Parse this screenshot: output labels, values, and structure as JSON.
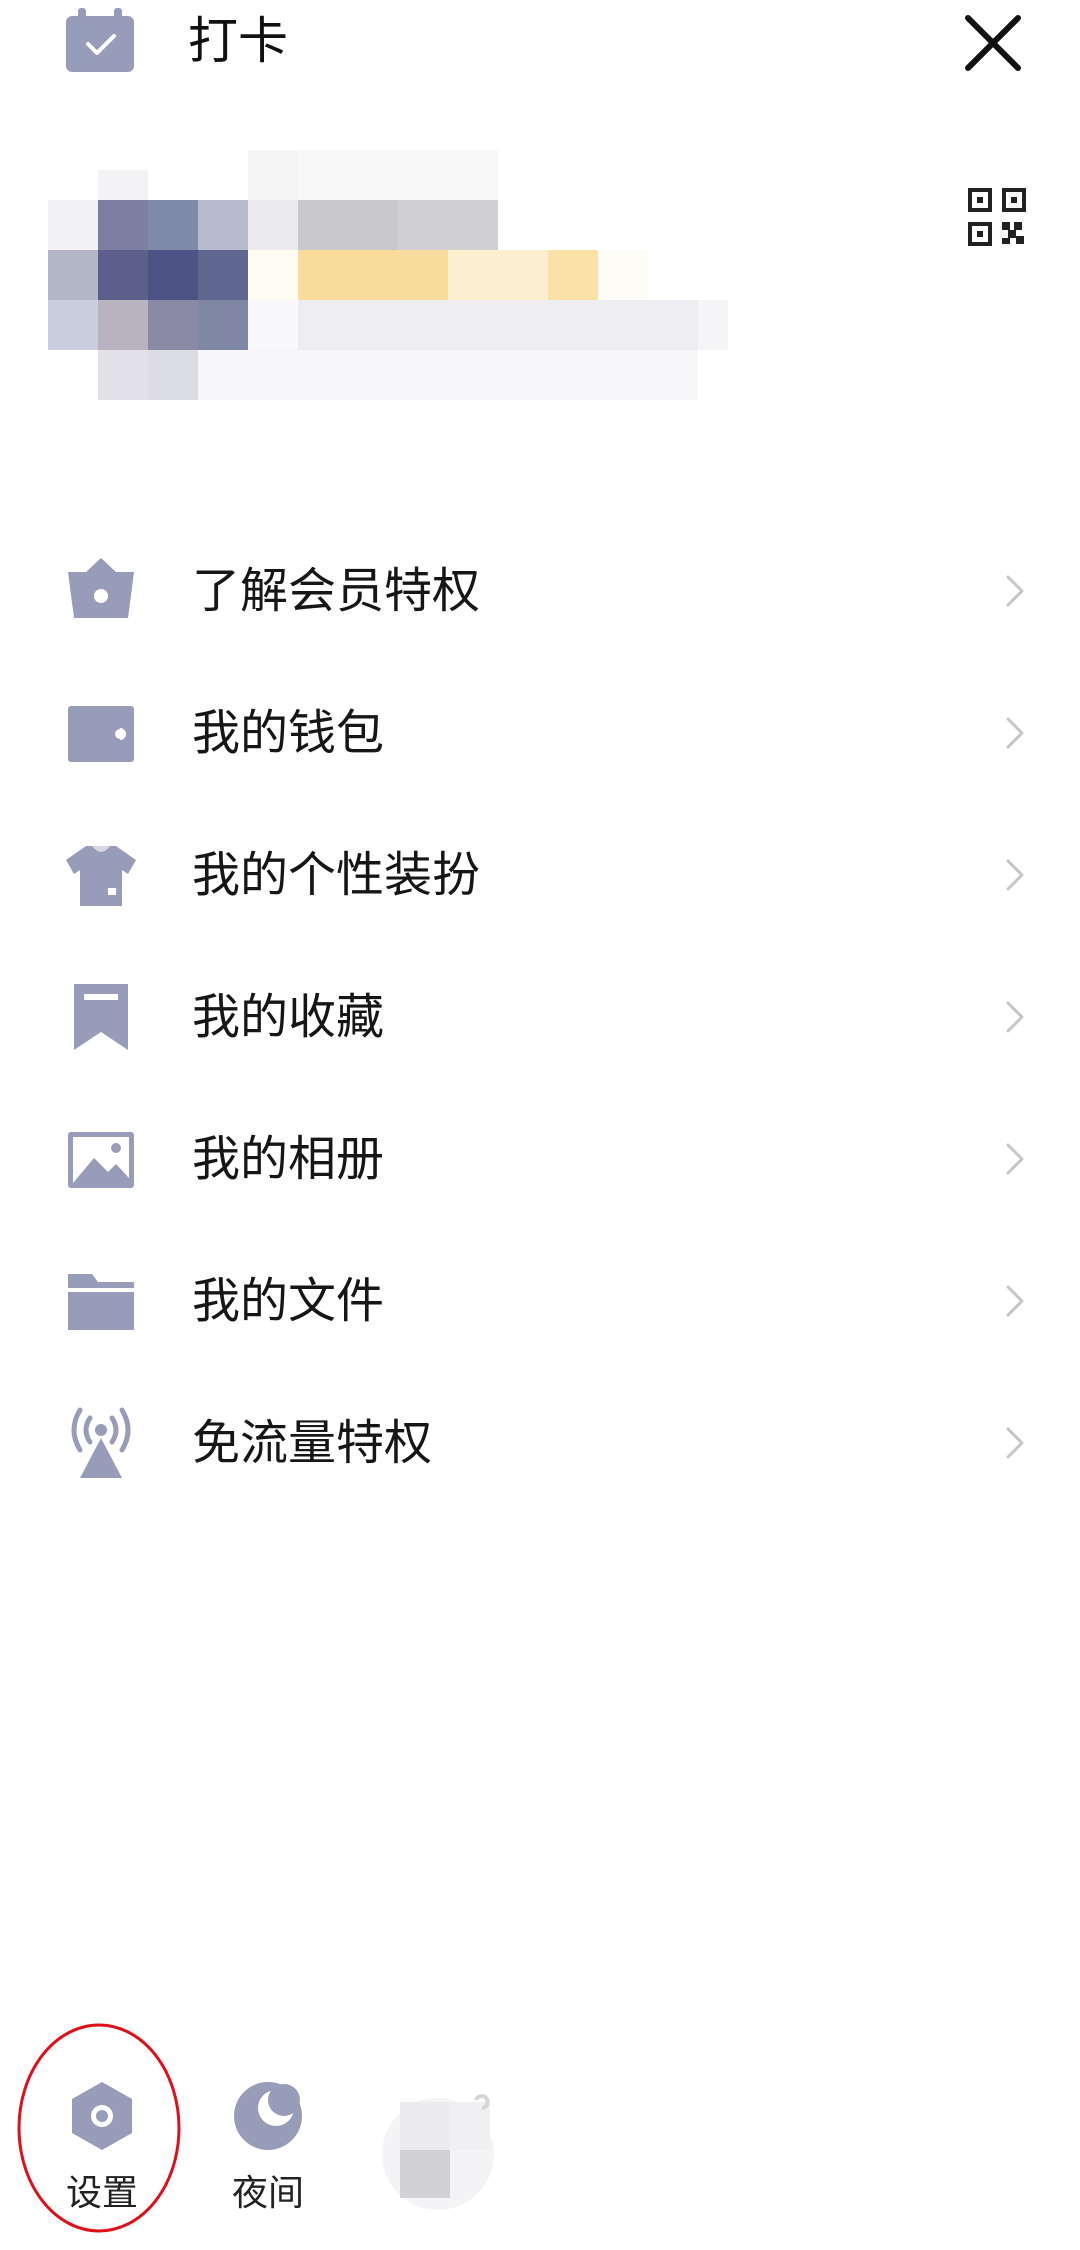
{
  "header": {
    "checkin_label": "打卡",
    "checkin_icon": "calendar-check-icon",
    "close_icon": "close-icon"
  },
  "profile": {
    "avatar": "blurred-avatar",
    "qr_icon": "qr-code-icon"
  },
  "menu": {
    "items": [
      {
        "label": "了解会员特权",
        "icon": "crown-basket-icon"
      },
      {
        "label": "我的钱包",
        "icon": "wallet-icon"
      },
      {
        "label": "我的个性装扮",
        "icon": "tshirt-icon"
      },
      {
        "label": "我的收藏",
        "icon": "bookmark-icon"
      },
      {
        "label": "我的相册",
        "icon": "image-icon"
      },
      {
        "label": "我的文件",
        "icon": "folder-icon"
      },
      {
        "label": "免流量特权",
        "icon": "signal-tower-icon"
      }
    ]
  },
  "bottom": {
    "settings_label": "设置",
    "night_label": "夜间",
    "settings_icon": "settings-hexagon-icon",
    "night_icon": "moon-icon"
  },
  "colors": {
    "icon": "#979db8",
    "chevron": "#c4c6cc",
    "highlight": "#e0101a"
  }
}
